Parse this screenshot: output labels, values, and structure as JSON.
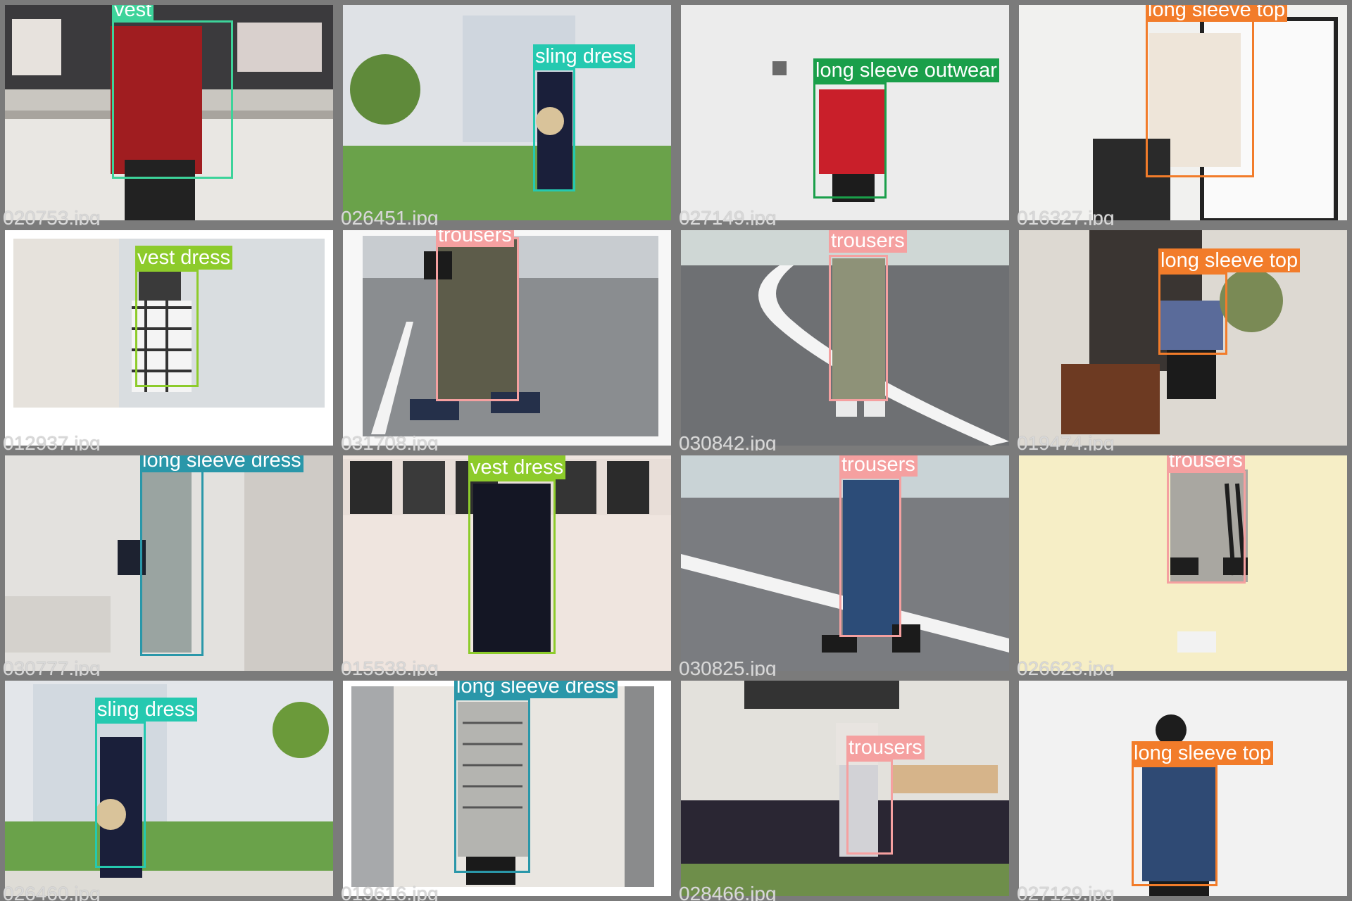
{
  "colors": {
    "vest": "#3dd39a",
    "sling dress": "#25c9b0",
    "long sleeve outwear": "#1a9f4a",
    "long sleeve top": "#f27c2a",
    "vest dress": "#8dcb2b",
    "trousers": "#f5a0a0",
    "long sleeve dress": "#2a97a9"
  },
  "tiles": [
    {
      "file": "020753.jpg",
      "label": "vest"
    },
    {
      "file": "026451.jpg",
      "label": "sling dress"
    },
    {
      "file": "027149.jpg",
      "label": "long sleeve outwear"
    },
    {
      "file": "016327.jpg",
      "label": "long sleeve top"
    },
    {
      "file": "012937.jpg",
      "label": "vest dress"
    },
    {
      "file": "031708.jpg",
      "label": "trousers"
    },
    {
      "file": "030842.jpg",
      "label": "trousers"
    },
    {
      "file": "019474.jpg",
      "label": "long sleeve top"
    },
    {
      "file": "030777.jpg",
      "label": "long sleeve dress"
    },
    {
      "file": "015538.jpg",
      "label": "vest dress"
    },
    {
      "file": "030825.jpg",
      "label": "trousers"
    },
    {
      "file": "026623.jpg",
      "label": "trousers"
    },
    {
      "file": "026460.jpg",
      "label": "sling dress"
    },
    {
      "file": "019616.jpg",
      "label": "long sleeve dress"
    },
    {
      "file": "028466.jpg",
      "label": "trousers"
    },
    {
      "file": "027129.jpg",
      "label": "long sleeve top"
    }
  ]
}
